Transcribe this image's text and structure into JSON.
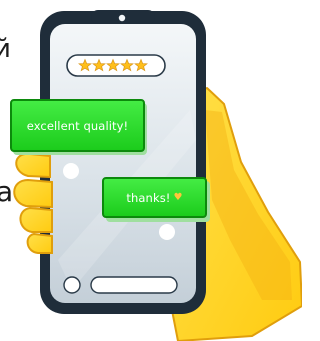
{
  "rating": {
    "stars": 5,
    "max": 5
  },
  "messages": [
    {
      "text": "excellent quality!"
    },
    {
      "text": "thanks!",
      "emoji": "♥"
    }
  ],
  "cropped_letters": {
    "top": "й",
    "bottom": "а"
  },
  "colors": {
    "phone_frame": "#1f2d3a",
    "screen": "#e3e9ee",
    "bubble": "#22d322",
    "bubble_border": "#0c8a0c",
    "hand": "#ffd21f",
    "hand_shadow": "#f5ae12",
    "star": "#ffbf1a",
    "heart": "#ffc53a"
  }
}
